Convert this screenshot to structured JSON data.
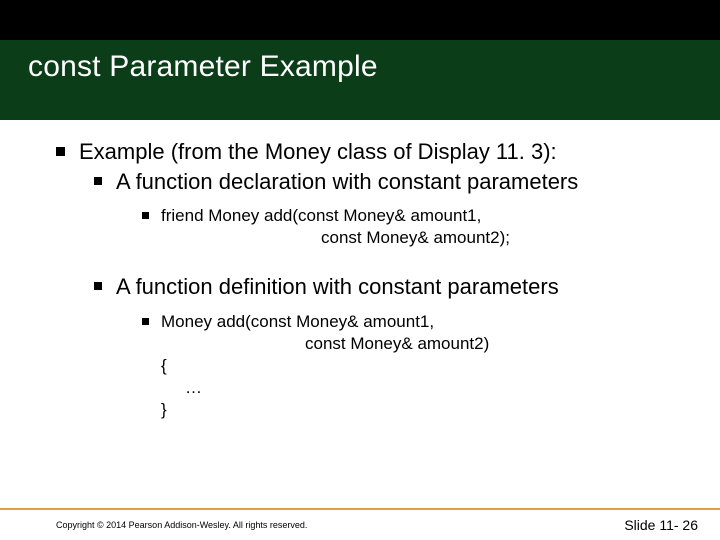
{
  "title": "const Parameter Example",
  "b1": "Example (from the Money class of Display 11. 3):",
  "b2a": "A function declaration with constant parameters",
  "code_a_l1": "friend Money add(const Money& amount1,",
  "code_a_l2": "const Money& amount2);",
  "b2b": "A function definition with constant parameters",
  "code_b_l1": "Money add(const Money& amount1,",
  "code_b_l2": "const Money& amount2)",
  "code_b_l3": "{",
  "code_b_l4": "…",
  "code_b_l5": "}",
  "copyright": "Copyright © 2014 Pearson Addison-Wesley.  All rights reserved.",
  "slide_number": "Slide 11- 26"
}
